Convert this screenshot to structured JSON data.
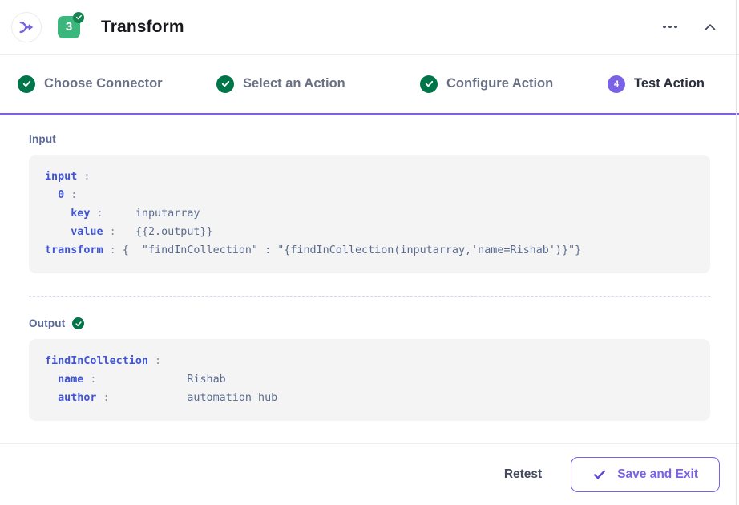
{
  "header": {
    "app_icon_name": "transform-merge-icon",
    "step_number": "3",
    "title": "Transform",
    "more_label": "more-options",
    "collapse_label": "collapse"
  },
  "steps": [
    {
      "label": "Choose Connector",
      "state": "done",
      "mark": "✓"
    },
    {
      "label": "Select an Action",
      "state": "done",
      "mark": "✓"
    },
    {
      "label": "Configure Action",
      "state": "done",
      "mark": "✓"
    },
    {
      "label": "Test Action",
      "state": "active",
      "mark": "4"
    }
  ],
  "input": {
    "title": "Input",
    "lines": [
      {
        "indent": 0,
        "key": "input",
        "sep": ":",
        "value": ""
      },
      {
        "indent": 1,
        "key": "0",
        "sep": ":",
        "value": ""
      },
      {
        "indent": 2,
        "key": "key",
        "sep": ":",
        "value": "inputarray"
      },
      {
        "indent": 2,
        "key": "value",
        "sep": ":",
        "value": "{{2.output}}"
      },
      {
        "indent": 0,
        "key": "transform",
        "sep": ":",
        "value": "{  \"findInCollection\" : \"{findInCollection(inputarray,'name=Rishab')}\"}"
      }
    ]
  },
  "output": {
    "title": "Output",
    "status_icon": "check-circle-icon",
    "lines": [
      {
        "indent": 0,
        "key": "findInCollection",
        "sep": ":",
        "value": ""
      },
      {
        "indent": 1,
        "key": "name",
        "sep": ":",
        "value": "Rishab"
      },
      {
        "indent": 1,
        "key": "author",
        "sep": ":",
        "value": "automation hub"
      }
    ]
  },
  "footer": {
    "retest_label": "Retest",
    "save_label": "Save and Exit"
  },
  "colors": {
    "accent_purple": "#7b61e4",
    "success_green": "#00754a",
    "badge_green": "#3bb77e",
    "code_bg": "#f4f4f5",
    "key_blue": "#4054d8"
  }
}
